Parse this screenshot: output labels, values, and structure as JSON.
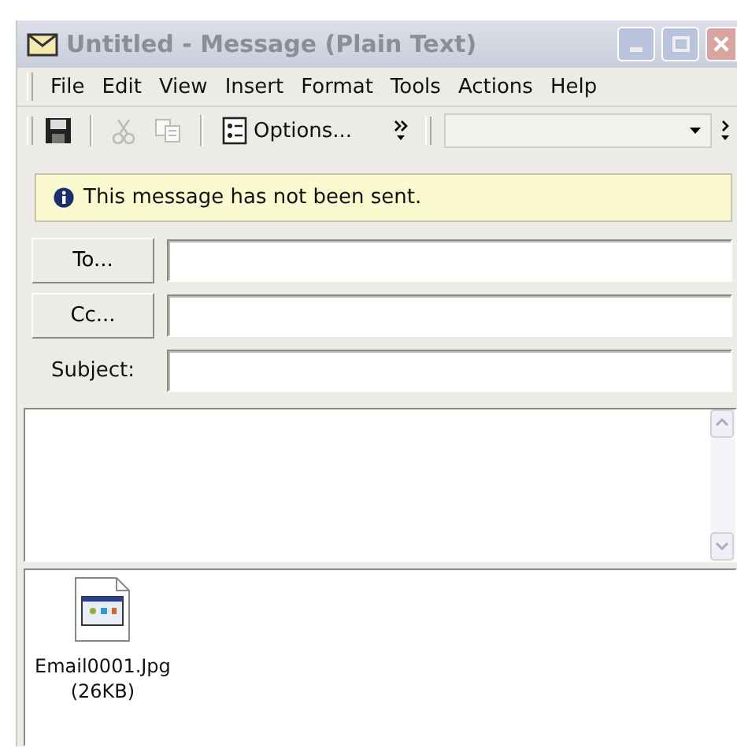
{
  "window": {
    "title": "Untitled - Message (Plain Text)",
    "active": false
  },
  "menu": [
    "File",
    "Edit",
    "View",
    "Insert",
    "Format",
    "Tools",
    "Actions",
    "Help"
  ],
  "toolbar": {
    "icon_buttons": [
      {
        "disabled": false
      },
      {
        "disabled": true
      },
      {
        "disabled": true
      }
    ],
    "options_button": {
      "label": "Options..."
    }
  },
  "info_bar": {
    "text": "This message has not been sent."
  },
  "header_fields": [
    {
      "kind": "button",
      "label": "To..."
    },
    {
      "kind": "button",
      "label": "Cc..."
    },
    {
      "kind": "label",
      "label": "Subject:"
    }
  ],
  "attachments": [
    {
      "name": "Email0001.Jpg",
      "size": "(26KB)"
    }
  ]
}
